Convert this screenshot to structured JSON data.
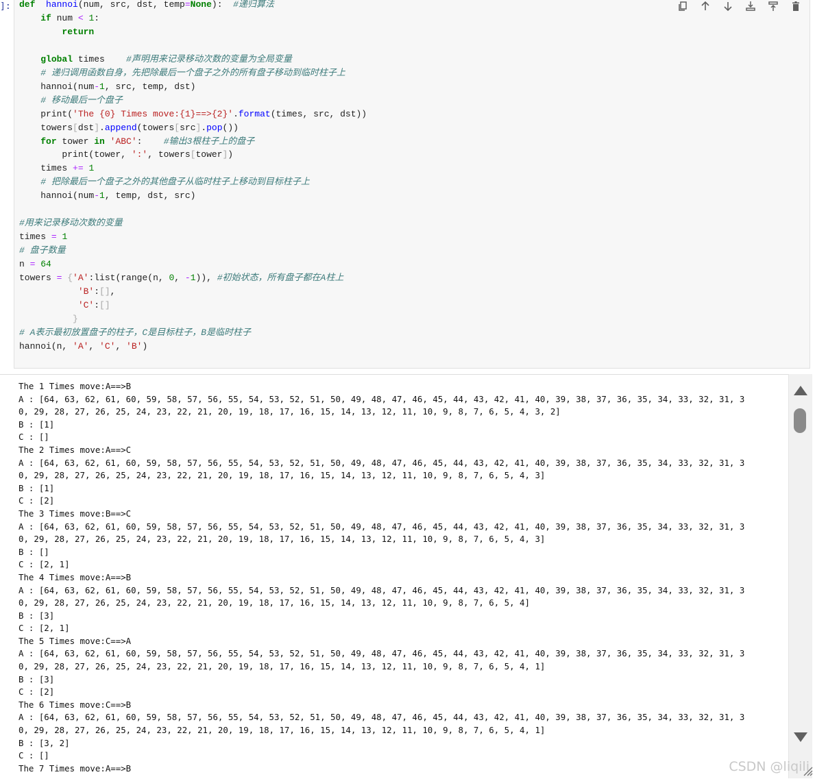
{
  "cell": {
    "prompt": "]:",
    "toolbar": [
      "copy-icon",
      "move-up-icon",
      "move-down-icon",
      "insert-above-icon",
      "insert-below-icon",
      "delete-icon"
    ]
  },
  "code": {
    "lines": [
      [
        [
          "kw",
          "def"
        ],
        [
          "",
          "  "
        ],
        [
          "fn",
          "hannoi"
        ],
        [
          "",
          "(num, src, dst, temp"
        ],
        [
          "op",
          "="
        ],
        [
          "kw",
          "None"
        ],
        [
          "",
          "):  "
        ],
        [
          "cm",
          "#递归算法"
        ]
      ],
      [
        [
          "",
          "    "
        ],
        [
          "kw",
          "if"
        ],
        [
          "",
          " num "
        ],
        [
          "op",
          "<"
        ],
        [
          "",
          " "
        ],
        [
          "num",
          "1"
        ],
        [
          "",
          ":"
        ]
      ],
      [
        [
          "",
          "        "
        ],
        [
          "kw",
          "return"
        ]
      ],
      [
        [
          "",
          ""
        ]
      ],
      [
        [
          "",
          "    "
        ],
        [
          "kw",
          "global"
        ],
        [
          "",
          " times    "
        ],
        [
          "cm",
          "#声明用来记录移动次数的变量为全局变量"
        ]
      ],
      [
        [
          "",
          "    "
        ],
        [
          "cm",
          "# 递归调用函数自身，先把除最后一个盘子之外的所有盘子移动到临时柱子上"
        ]
      ],
      [
        [
          "",
          "    hannoi(num"
        ],
        [
          "op",
          "-"
        ],
        [
          "num",
          "1"
        ],
        [
          "",
          ", src, temp, dst)"
        ]
      ],
      [
        [
          "",
          "    "
        ],
        [
          "cm",
          "# 移动最后一个盘子"
        ]
      ],
      [
        [
          "",
          "    print("
        ],
        [
          "str",
          "'The {0} Times move:{1}==>{2}'"
        ],
        [
          "",
          "."
        ],
        [
          "fn",
          "format"
        ],
        [
          "",
          "(times, src, dst))"
        ]
      ],
      [
        [
          "",
          "    towers"
        ],
        [
          "br",
          "["
        ],
        [
          "",
          "dst"
        ],
        [
          "br",
          "]"
        ],
        [
          "",
          "."
        ],
        [
          "fn",
          "append"
        ],
        [
          "",
          "(towers"
        ],
        [
          "br",
          "["
        ],
        [
          "",
          "src"
        ],
        [
          "br",
          "]"
        ],
        [
          "",
          "."
        ],
        [
          "fn",
          "pop"
        ],
        [
          "",
          "())"
        ]
      ],
      [
        [
          "",
          "    "
        ],
        [
          "kw",
          "for"
        ],
        [
          "",
          " tower "
        ],
        [
          "kw",
          "in"
        ],
        [
          "",
          " "
        ],
        [
          "str",
          "'ABC'"
        ],
        [
          "",
          ":    "
        ],
        [
          "cm",
          "#输出3根柱子上的盘子"
        ]
      ],
      [
        [
          "",
          "        print(tower, "
        ],
        [
          "str",
          "':'"
        ],
        [
          "",
          ", towers"
        ],
        [
          "br",
          "["
        ],
        [
          "",
          "tower"
        ],
        [
          "br",
          "]"
        ],
        [
          "",
          ")"
        ]
      ],
      [
        [
          "",
          "    times "
        ],
        [
          "op",
          "+="
        ],
        [
          "",
          " "
        ],
        [
          "num",
          "1"
        ]
      ],
      [
        [
          "",
          "    "
        ],
        [
          "cm",
          "# 把除最后一个盘子之外的其他盘子从临时柱子上移动到目标柱子上"
        ]
      ],
      [
        [
          "",
          "    hannoi(num"
        ],
        [
          "op",
          "-"
        ],
        [
          "num",
          "1"
        ],
        [
          "",
          ", temp, dst, src)"
        ]
      ],
      [
        [
          "",
          ""
        ]
      ],
      [
        [
          "cm",
          "#用来记录移动次数的变量"
        ]
      ],
      [
        [
          "",
          "times "
        ],
        [
          "op",
          "="
        ],
        [
          "",
          " "
        ],
        [
          "num",
          "1"
        ]
      ],
      [
        [
          "cm",
          "# 盘子数量"
        ]
      ],
      [
        [
          "",
          "n "
        ],
        [
          "op",
          "="
        ],
        [
          "",
          " "
        ],
        [
          "num",
          "64"
        ]
      ],
      [
        [
          "",
          "towers "
        ],
        [
          "op",
          "="
        ],
        [
          "",
          " "
        ],
        [
          "br",
          "{"
        ],
        [
          "str",
          "'A'"
        ],
        [
          "",
          ":list(range(n, "
        ],
        [
          "num",
          "0"
        ],
        [
          "",
          ", "
        ],
        [
          "op",
          "-"
        ],
        [
          "num",
          "1"
        ],
        [
          "",
          ")), "
        ],
        [
          "cm",
          "#初始状态，所有盘子都在A柱上"
        ]
      ],
      [
        [
          "",
          "           "
        ],
        [
          "str",
          "'B'"
        ],
        [
          "",
          ":"
        ],
        [
          "br",
          "[]"
        ],
        [
          "",
          ","
        ]
      ],
      [
        [
          "",
          "           "
        ],
        [
          "str",
          "'C'"
        ],
        [
          "",
          ":"
        ],
        [
          "br",
          "[]"
        ]
      ],
      [
        [
          "",
          "          "
        ],
        [
          "br",
          "}"
        ]
      ],
      [
        [
          "cm",
          "# A表示最初放置盘子的柱子，C是目标柱子，B是临时柱子"
        ]
      ],
      [
        [
          "",
          "hannoi(n, "
        ],
        [
          "str",
          "'A'"
        ],
        [
          "",
          ", "
        ],
        [
          "str",
          "'C'"
        ],
        [
          "",
          ", "
        ],
        [
          "str",
          "'B'"
        ],
        [
          "",
          ")"
        ]
      ]
    ]
  },
  "output": {
    "lines": [
      "The 1 Times move:A==>B",
      "A : [64, 63, 62, 61, 60, 59, 58, 57, 56, 55, 54, 53, 52, 51, 50, 49, 48, 47, 46, 45, 44, 43, 42, 41, 40, 39, 38, 37, 36, 35, 34, 33, 32, 31, 3",
      "0, 29, 28, 27, 26, 25, 24, 23, 22, 21, 20, 19, 18, 17, 16, 15, 14, 13, 12, 11, 10, 9, 8, 7, 6, 5, 4, 3, 2]",
      "B : [1]",
      "C : []",
      "The 2 Times move:A==>C",
      "A : [64, 63, 62, 61, 60, 59, 58, 57, 56, 55, 54, 53, 52, 51, 50, 49, 48, 47, 46, 45, 44, 43, 42, 41, 40, 39, 38, 37, 36, 35, 34, 33, 32, 31, 3",
      "0, 29, 28, 27, 26, 25, 24, 23, 22, 21, 20, 19, 18, 17, 16, 15, 14, 13, 12, 11, 10, 9, 8, 7, 6, 5, 4, 3]",
      "B : [1]",
      "C : [2]",
      "The 3 Times move:B==>C",
      "A : [64, 63, 62, 61, 60, 59, 58, 57, 56, 55, 54, 53, 52, 51, 50, 49, 48, 47, 46, 45, 44, 43, 42, 41, 40, 39, 38, 37, 36, 35, 34, 33, 32, 31, 3",
      "0, 29, 28, 27, 26, 25, 24, 23, 22, 21, 20, 19, 18, 17, 16, 15, 14, 13, 12, 11, 10, 9, 8, 7, 6, 5, 4, 3]",
      "B : []",
      "C : [2, 1]",
      "The 4 Times move:A==>B",
      "A : [64, 63, 62, 61, 60, 59, 58, 57, 56, 55, 54, 53, 52, 51, 50, 49, 48, 47, 46, 45, 44, 43, 42, 41, 40, 39, 38, 37, 36, 35, 34, 33, 32, 31, 3",
      "0, 29, 28, 27, 26, 25, 24, 23, 22, 21, 20, 19, 18, 17, 16, 15, 14, 13, 12, 11, 10, 9, 8, 7, 6, 5, 4]",
      "B : [3]",
      "C : [2, 1]",
      "The 5 Times move:C==>A",
      "A : [64, 63, 62, 61, 60, 59, 58, 57, 56, 55, 54, 53, 52, 51, 50, 49, 48, 47, 46, 45, 44, 43, 42, 41, 40, 39, 38, 37, 36, 35, 34, 33, 32, 31, 3",
      "0, 29, 28, 27, 26, 25, 24, 23, 22, 21, 20, 19, 18, 17, 16, 15, 14, 13, 12, 11, 10, 9, 8, 7, 6, 5, 4, 1]",
      "B : [3]",
      "C : [2]",
      "The 6 Times move:C==>B",
      "A : [64, 63, 62, 61, 60, 59, 58, 57, 56, 55, 54, 53, 52, 51, 50, 49, 48, 47, 46, 45, 44, 43, 42, 41, 40, 39, 38, 37, 36, 35, 34, 33, 32, 31, 3",
      "0, 29, 28, 27, 26, 25, 24, 23, 22, 21, 20, 19, 18, 17, 16, 15, 14, 13, 12, 11, 10, 9, 8, 7, 6, 5, 4, 1]",
      "B : [3, 2]",
      "C : []",
      "The 7 Times move:A==>B"
    ]
  },
  "watermark": "CSDN @liqili"
}
